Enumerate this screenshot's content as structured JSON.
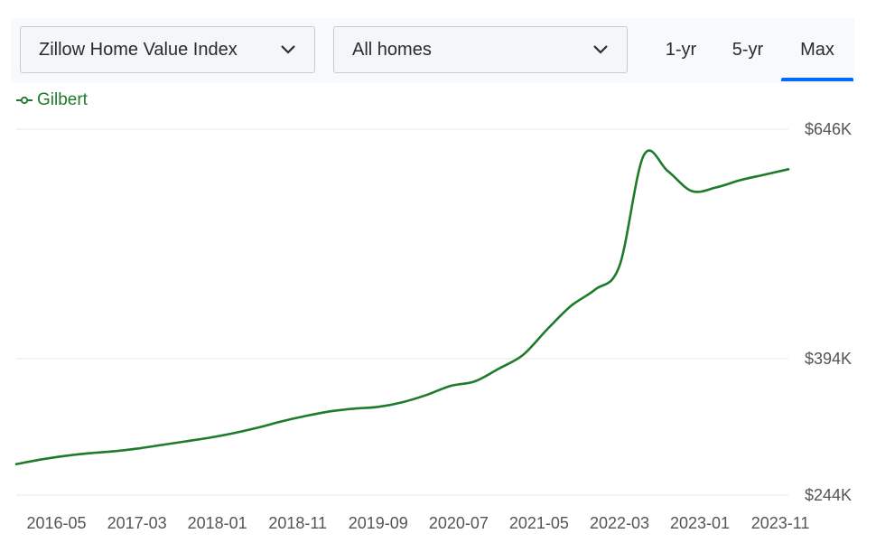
{
  "controls": {
    "metric_select": "Zillow Home Value Index",
    "home_type_select": "All homes",
    "tabs": [
      {
        "label": "1-yr",
        "active": false
      },
      {
        "label": "5-yr",
        "active": false
      },
      {
        "label": "Max",
        "active": true
      }
    ]
  },
  "colors": {
    "series": "#1e7b2c",
    "accent": "#006aff",
    "grid": "#e6e7e8"
  },
  "chart_data": {
    "type": "line",
    "title": "",
    "xlabel": "",
    "ylabel": "",
    "legend_position": "top-left",
    "grid": true,
    "y_tick_labels": [
      "$646K",
      "$394K",
      "$244K"
    ],
    "y_ticks": [
      646,
      394,
      244
    ],
    "ylim": [
      244,
      646
    ],
    "x_tick_labels": [
      "2016-05",
      "2017-03",
      "2018-01",
      "2018-11",
      "2019-09",
      "2020-07",
      "2021-05",
      "2022-03",
      "2023-01",
      "2023-11"
    ],
    "series": [
      {
        "name": "Gilbert",
        "x": [
          "2015-12",
          "2016-03",
          "2016-06",
          "2016-09",
          "2016-12",
          "2017-03",
          "2017-06",
          "2017-09",
          "2017-12",
          "2018-03",
          "2018-06",
          "2018-09",
          "2018-12",
          "2019-03",
          "2019-06",
          "2019-09",
          "2019-12",
          "2020-03",
          "2020-06",
          "2020-09",
          "2020-12",
          "2021-03",
          "2021-06",
          "2021-09",
          "2021-12",
          "2022-03",
          "2022-06",
          "2022-09",
          "2022-12",
          "2023-03",
          "2023-06",
          "2023-09",
          "2023-12"
        ],
        "values": [
          278,
          283,
          287,
          290,
          292,
          295,
          299,
          303,
          307,
          312,
          318,
          325,
          331,
          336,
          339,
          341,
          346,
          354,
          364,
          369,
          383,
          398,
          426,
          452,
          470,
          496,
          617,
          600,
          578,
          582,
          590,
          596,
          602
        ]
      }
    ]
  }
}
